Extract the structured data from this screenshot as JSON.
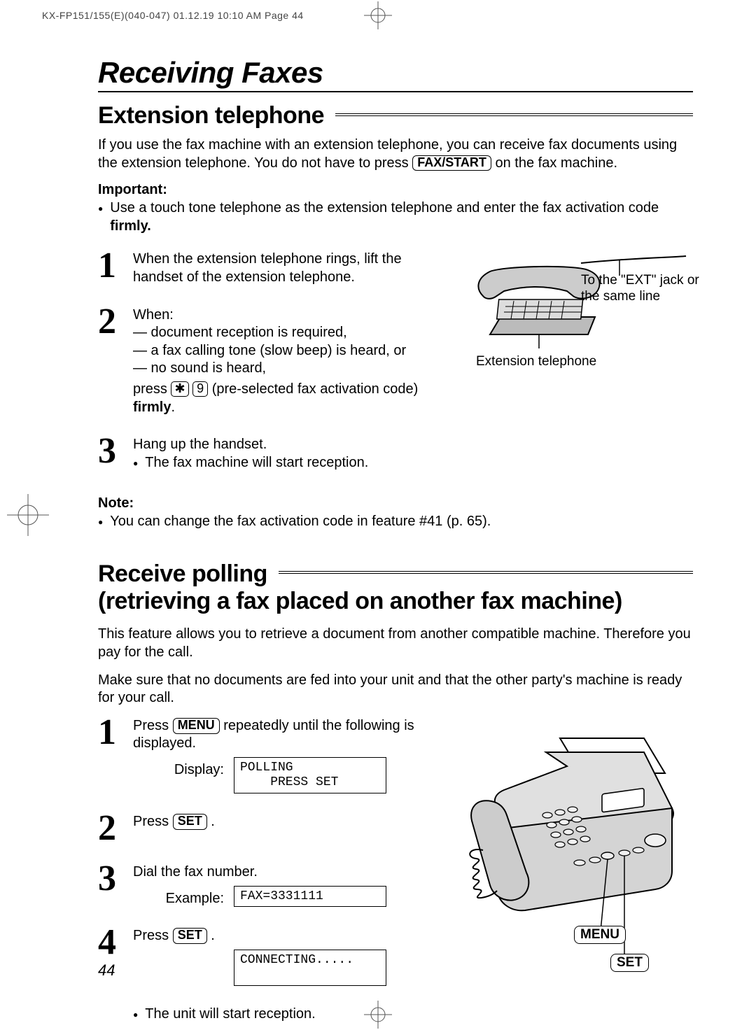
{
  "print_header": "KX-FP151/155(E)(040-047)  01.12.19 10:10 AM  Page 44",
  "page_title": "Receiving Faxes",
  "page_number": "44",
  "section1": {
    "heading": "Extension telephone",
    "intro_pre": "If you use the fax machine with an extension telephone, you can receive fax documents using the extension telephone. You do not have to press ",
    "intro_btn": "FAX/START",
    "intro_post": " on the fax machine.",
    "important_label": "Important:",
    "important_bullet_pre": "Use a touch tone telephone as the extension telephone and enter the fax activation code ",
    "important_bullet_bold": "firmly.",
    "steps": {
      "s1": {
        "num": "1",
        "text": "When the extension telephone rings, lift the handset of the extension telephone."
      },
      "s2": {
        "num": "2",
        "when": "When:",
        "l1": "— document reception is required,",
        "l2": "— a fax calling tone (slow beep) is heard, or",
        "l3": "— no sound is heard,",
        "press_pre": "press ",
        "key1": "✱",
        "key2": "9",
        "press_mid": " (pre-selected fax activation code) ",
        "press_bold": "firmly",
        "press_end": "."
      },
      "s3": {
        "num": "3",
        "l1": "Hang up the handset.",
        "bullet": "The fax machine will start reception."
      }
    },
    "figure": {
      "label_right": "To the \"EXT\" jack or the same line",
      "label_bottom": "Extension telephone"
    },
    "note_label": "Note:",
    "note_bullet": "You can change the fax activation code in feature #41 (p. 65)."
  },
  "section2": {
    "heading_line1": "Receive polling",
    "heading_line2": "(retrieving a fax placed on another fax machine)",
    "intro1": "This feature allows you to retrieve a document from another compatible machine. Therefore you pay for the call.",
    "intro2": "Make sure that no documents are fed into your unit and that the other party's machine is ready for your call.",
    "steps": {
      "s1": {
        "num": "1",
        "pre": "Press ",
        "btn": "MENU",
        "post": " repeatedly until the following is displayed.",
        "display_label": "Display:",
        "display_text": "POLLING\n    PRESS SET"
      },
      "s2": {
        "num": "2",
        "pre": "Press ",
        "btn": "SET",
        "post": " ."
      },
      "s3": {
        "num": "3",
        "text": "Dial the fax number.",
        "display_label": "Example:",
        "display_text": "FAX=3331111"
      },
      "s4": {
        "num": "4",
        "pre": "Press ",
        "btn": "SET",
        "post": " .",
        "display_text": "CONNECTING.....",
        "final_bullet": "The unit will start reception."
      }
    },
    "figure": {
      "menu_btn": "MENU",
      "set_btn": "SET"
    }
  }
}
